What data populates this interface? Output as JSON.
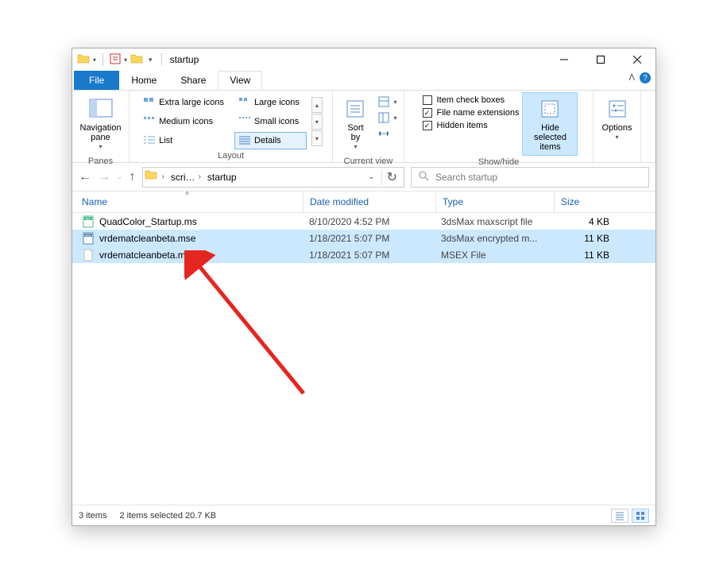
{
  "window": {
    "title": "startup"
  },
  "tabs": {
    "file": "File",
    "home": "Home",
    "share": "Share",
    "view": "View"
  },
  "ribbon": {
    "panes": {
      "label": "Panes",
      "nav_pane": "Navigation\npane"
    },
    "layout": {
      "label": "Layout",
      "items": [
        "Extra large icons",
        "Large icons",
        "Medium icons",
        "Small icons",
        "List",
        "Details"
      ]
    },
    "current_view": {
      "label": "Current view",
      "sort_by": "Sort\nby"
    },
    "show_hide": {
      "label": "Show/hide",
      "item_check": "Item check boxes",
      "file_ext": "File name extensions",
      "hidden": "Hidden items",
      "hide_selected": "Hide selected\nitems"
    },
    "options": "Options"
  },
  "breadcrumb": {
    "seg1": "scri…",
    "seg2": "startup"
  },
  "search": {
    "placeholder": "Search startup"
  },
  "columns": {
    "name": "Name",
    "date": "Date modified",
    "type": "Type",
    "size": "Size"
  },
  "files": [
    {
      "icon": "ms",
      "name": "QuadColor_Startup.ms",
      "date": "8/10/2020 4:52 PM",
      "type": "3dsMax maxscript file",
      "size": "4 KB",
      "selected": false
    },
    {
      "icon": "mse",
      "name": "vrdematcleanbeta.mse",
      "date": "1/18/2021 5:07 PM",
      "type": "3dsMax encrypted m...",
      "size": "11 KB",
      "selected": true
    },
    {
      "icon": "blank",
      "name": "vrdematcleanbeta.msex",
      "date": "1/18/2021 5:07 PM",
      "type": "MSEX File",
      "size": "11 KB",
      "selected": true
    }
  ],
  "status": {
    "count": "3 items",
    "selection": "2 items selected  20.7 KB"
  }
}
